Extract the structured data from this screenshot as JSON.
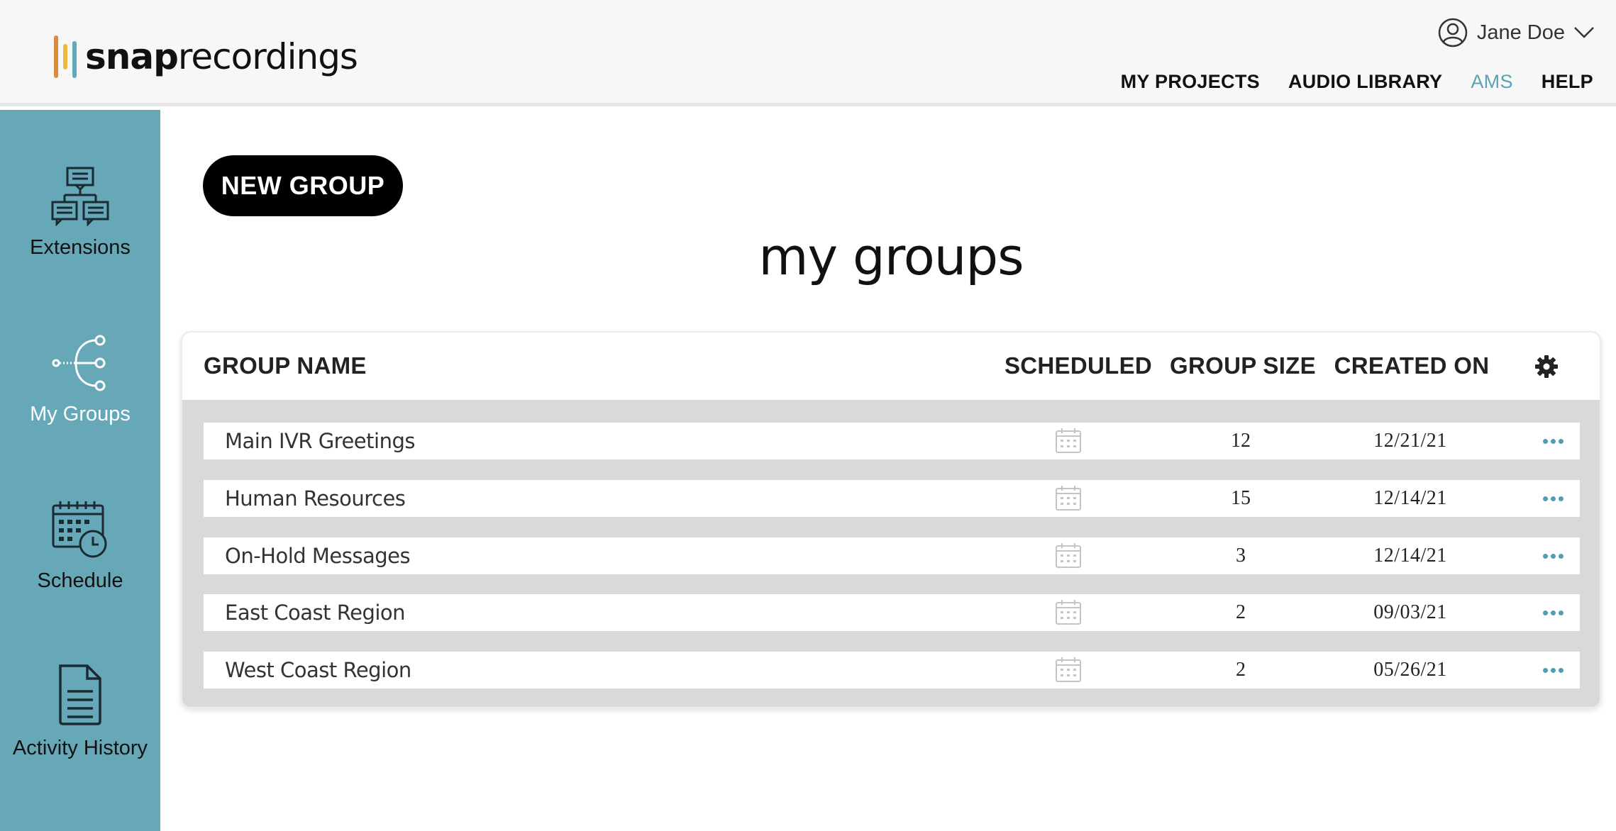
{
  "brand": {
    "name_bold": "snap",
    "name_light": "recordings",
    "bar_colors": [
      "#d98a3a",
      "#efb73e",
      "#63a8bb"
    ]
  },
  "header": {
    "user_name": "Jane Doe",
    "nav": [
      {
        "label": "MY PROJECTS",
        "active": false
      },
      {
        "label": "AUDIO LIBRARY",
        "active": false
      },
      {
        "label": "AMS",
        "active": true
      },
      {
        "label": "HELP",
        "active": false
      }
    ]
  },
  "sidebar": {
    "items": [
      {
        "label": "Extensions",
        "icon": "extensions-icon",
        "active": false
      },
      {
        "label": "My Groups",
        "icon": "groups-tree-icon",
        "active": true
      },
      {
        "label": "Schedule",
        "icon": "schedule-calendar-icon",
        "active": false
      },
      {
        "label": "Activity History",
        "icon": "document-icon",
        "active": false
      }
    ]
  },
  "main": {
    "new_group_label": "NEW GROUP",
    "title": "my groups",
    "table": {
      "headers": {
        "name": "GROUP NAME",
        "scheduled": "SCHEDULED",
        "size": "GROUP SIZE",
        "created": "CREATED ON"
      },
      "rows": [
        {
          "name": "Main IVR Greetings",
          "size": "12",
          "created": "12/21/21"
        },
        {
          "name": "Human Resources",
          "size": "15",
          "created": "12/14/21"
        },
        {
          "name": "On-Hold Messages",
          "size": "3",
          "created": "12/14/21"
        },
        {
          "name": "East Coast Region",
          "size": "2",
          "created": "09/03/21"
        },
        {
          "name": "West Coast Region",
          "size": "2",
          "created": "05/26/21"
        }
      ]
    }
  },
  "colors": {
    "accent": "#66a8b8",
    "nav_active": "#5aa3b7",
    "dots": "#4f9fb3"
  }
}
